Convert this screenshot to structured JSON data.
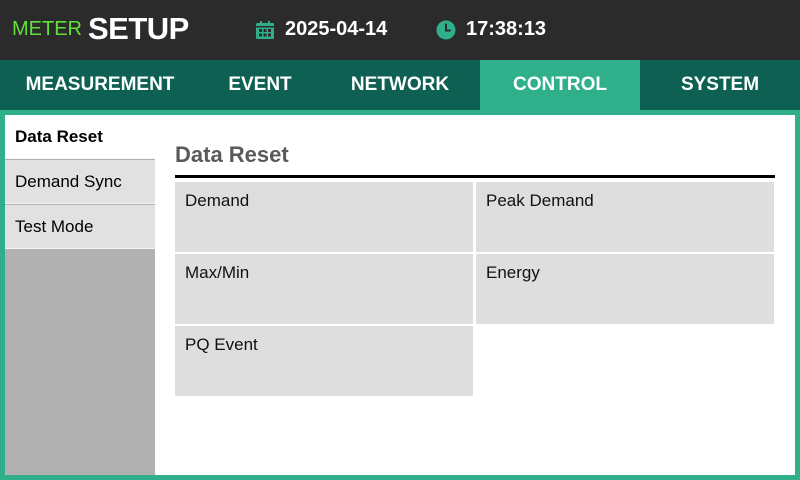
{
  "header": {
    "brand_prefix": "METER",
    "brand_title": "SETUP",
    "date": "2025-04-14",
    "time": "17:38:13",
    "icons": {
      "date": "calendar-icon",
      "time": "clock-icon"
    }
  },
  "tabs": [
    {
      "label": "MEASUREMENT",
      "active": false
    },
    {
      "label": "EVENT",
      "active": false
    },
    {
      "label": "NETWORK",
      "active": false
    },
    {
      "label": "CONTROL",
      "active": true
    },
    {
      "label": "SYSTEM",
      "active": false
    }
  ],
  "sidebar": {
    "items": [
      {
        "label": "Data Reset",
        "active": true
      },
      {
        "label": "Demand Sync",
        "active": false
      },
      {
        "label": "Test Mode",
        "active": false
      }
    ]
  },
  "main": {
    "title": "Data Reset",
    "options": [
      {
        "label": "Demand"
      },
      {
        "label": "Peak Demand"
      },
      {
        "label": "Max/Min"
      },
      {
        "label": "Energy"
      },
      {
        "label": "PQ Event"
      }
    ]
  },
  "colors": {
    "accent": "#2fb08a",
    "tab_bar": "#0e6152",
    "header_bg": "#2b2b2b",
    "brand_green": "#62e03a"
  }
}
